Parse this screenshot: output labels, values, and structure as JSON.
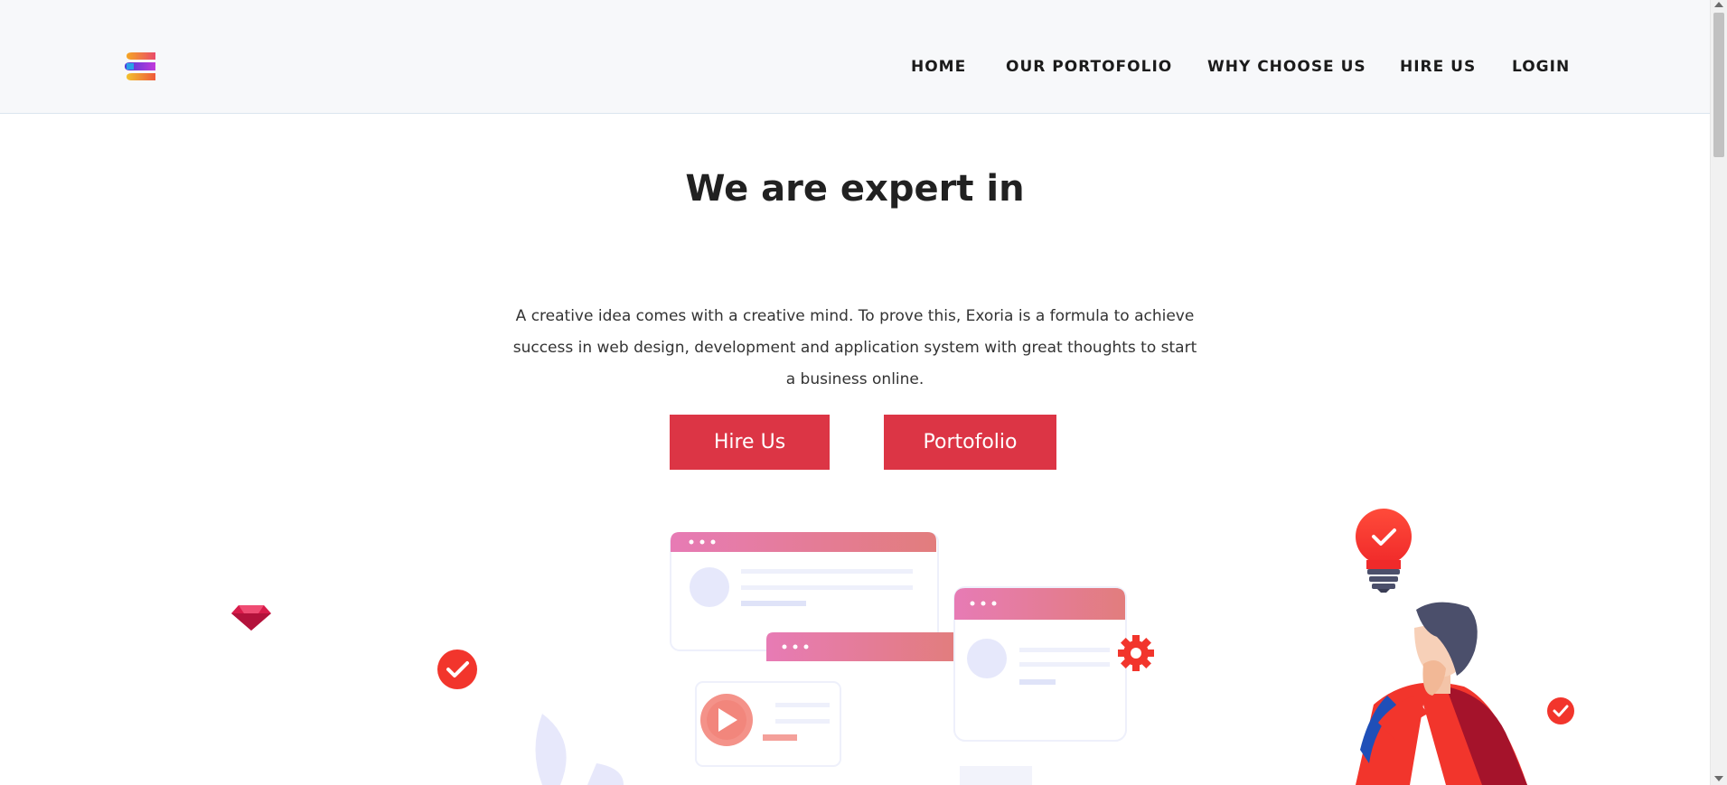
{
  "header": {
    "logo_icon": "brand-logo-icon",
    "nav": [
      {
        "label": "HOME"
      },
      {
        "label": "OUR PORTOFOLIO"
      },
      {
        "label": "WHY CHOOSE US"
      },
      {
        "label": "HIRE US"
      },
      {
        "label": "LOGIN"
      }
    ]
  },
  "hero": {
    "title": "We are expert in",
    "description": "A creative idea comes with a creative mind. To prove this, Exoria is a formula to achieve success in web design, development and application system with great thoughts to start a business online.",
    "buttons": {
      "hire": "Hire Us",
      "portfolio": "Portofolio"
    }
  },
  "colors": {
    "accent": "#dc3545",
    "header_bg": "#f7f8fa",
    "window_gradient_start": "#e77bb5",
    "window_gradient_end": "#e27d7d"
  },
  "illustration": {
    "icons": [
      "diamond-icon",
      "check-badge-icon",
      "play-icon",
      "gear-icon",
      "lightbulb-check-icon",
      "thinking-person"
    ]
  }
}
